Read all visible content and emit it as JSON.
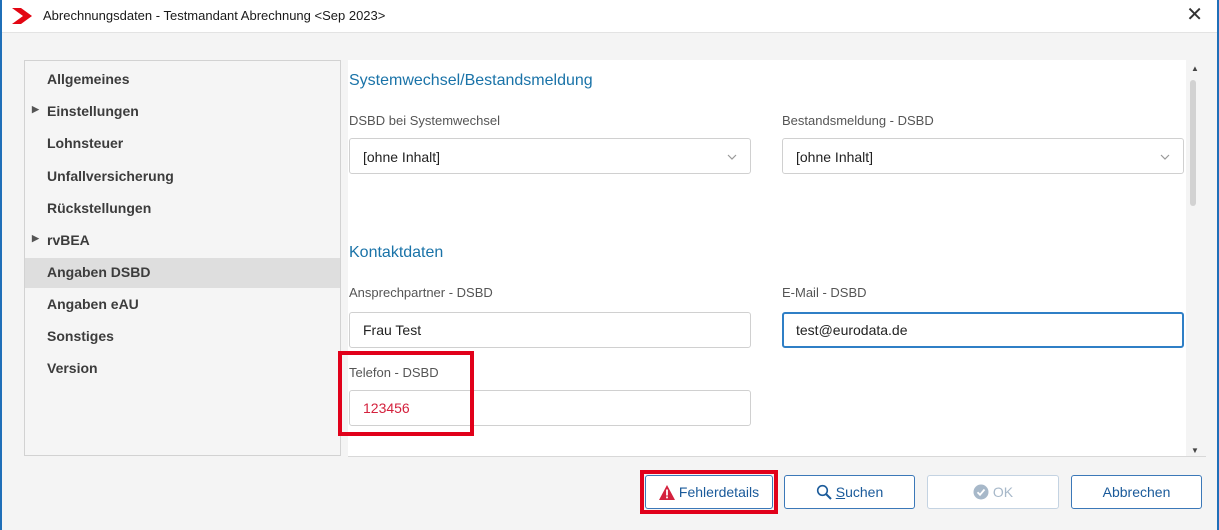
{
  "window": {
    "title": "Abrechnungsdaten - Testmandant Abrechnung <Sep 2023>",
    "close_symbol": "✕"
  },
  "sidebar": {
    "items": [
      {
        "label": "Allgemeines",
        "expandable": false,
        "active": false
      },
      {
        "label": "Einstellungen",
        "expandable": true,
        "active": false
      },
      {
        "label": "Lohnsteuer",
        "expandable": false,
        "active": false
      },
      {
        "label": "Unfallversicherung",
        "expandable": false,
        "active": false
      },
      {
        "label": "Rückstellungen",
        "expandable": false,
        "active": false
      },
      {
        "label": "rvBEA",
        "expandable": true,
        "active": false
      },
      {
        "label": "Angaben DSBD",
        "expandable": false,
        "active": true
      },
      {
        "label": "Angaben eAU",
        "expandable": false,
        "active": false
      },
      {
        "label": "Sonstiges",
        "expandable": false,
        "active": false
      },
      {
        "label": "Version",
        "expandable": false,
        "active": false
      }
    ]
  },
  "content": {
    "section1_title": "Systemwechsel/Bestandsmeldung",
    "dsbd_systemwechsel": {
      "label": "DSBD bei Systemwechsel",
      "value": "[ohne Inhalt]"
    },
    "bestandsmeldung": {
      "label": "Bestandsmeldung - DSBD",
      "value": "[ohne Inhalt]"
    },
    "section2_title": "Kontaktdaten",
    "ansprechpartner": {
      "label": "Ansprechpartner - DSBD",
      "value": "Frau Test"
    },
    "email": {
      "label": "E-Mail - DSBD",
      "value": "test@eurodata.de"
    },
    "telefon": {
      "label": "Telefon - DSBD",
      "value": "123456"
    }
  },
  "buttons": {
    "fehlerdetails": "Fehlerdetails",
    "suchen_underlined": "S",
    "suchen_rest": "uchen",
    "ok": "OK",
    "abbrechen": "Abbrechen"
  },
  "colors": {
    "accent": "#1a73a8",
    "error_text": "#d4213d",
    "highlight_box": "#e1001a",
    "window_border": "#1f6fb8"
  },
  "icons": {
    "app_logo": "red-chevron-icon",
    "warning": "warning-triangle-icon",
    "search": "magnifier-icon",
    "ok": "check-circle-icon"
  }
}
